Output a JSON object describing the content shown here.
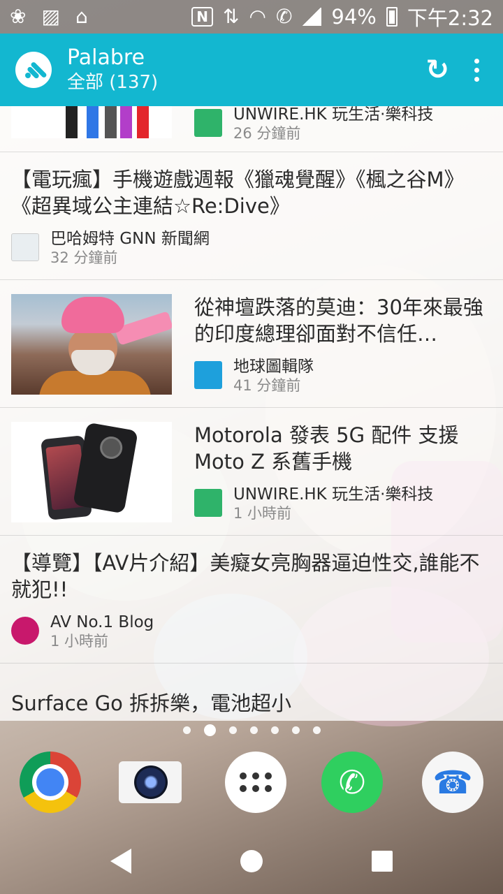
{
  "status_bar": {
    "battery": "94%",
    "time": "下午2:32",
    "nfc_label": "N"
  },
  "app_bar": {
    "title": "Palabre",
    "subtitle": "全部 (137)"
  },
  "feed": [
    {
      "title": "",
      "source": "UNWIRE.HK 玩生活·樂科技",
      "time": "26 分鐘前",
      "accent": "#2fb36a"
    },
    {
      "title": "【電玩瘋】手機遊戲週報《獵魂覺醒》《楓之谷M》《超異域公主連結☆Re:Dive》",
      "source": "巴哈姆特 GNN 新聞網",
      "time": "32 分鐘前"
    },
    {
      "title": "從神壇跌落的莫迪：30年來最強的印度總理卻面對不信任…",
      "source": "地球圖輯隊",
      "time": "41 分鐘前",
      "accent": "#1ea0dc"
    },
    {
      "title": "Motorola 發表 5G 配件 支援 Moto Z 系舊手機",
      "source": "UNWIRE.HK 玩生活·樂科技",
      "time": "1 小時前",
      "accent": "#2fb36a"
    },
    {
      "title": "【導覽】【AV片介紹】美癡女亮胸器逼迫性交,誰能不就犯!!",
      "source": "AV No.1 Blog",
      "time": "1 小時前",
      "accent": "#c8186c"
    },
    {
      "title": "Surface Go 拆拆樂，電池超小"
    }
  ],
  "dock": {
    "apps": [
      "chrome-icon",
      "camera-icon",
      "app-drawer-icon",
      "whatsapp-icon",
      "phone-icon"
    ],
    "pages": 7,
    "active_page": 2
  },
  "colors": {
    "app_bar": "#13b7d0",
    "status_bar": "#3c3737"
  }
}
